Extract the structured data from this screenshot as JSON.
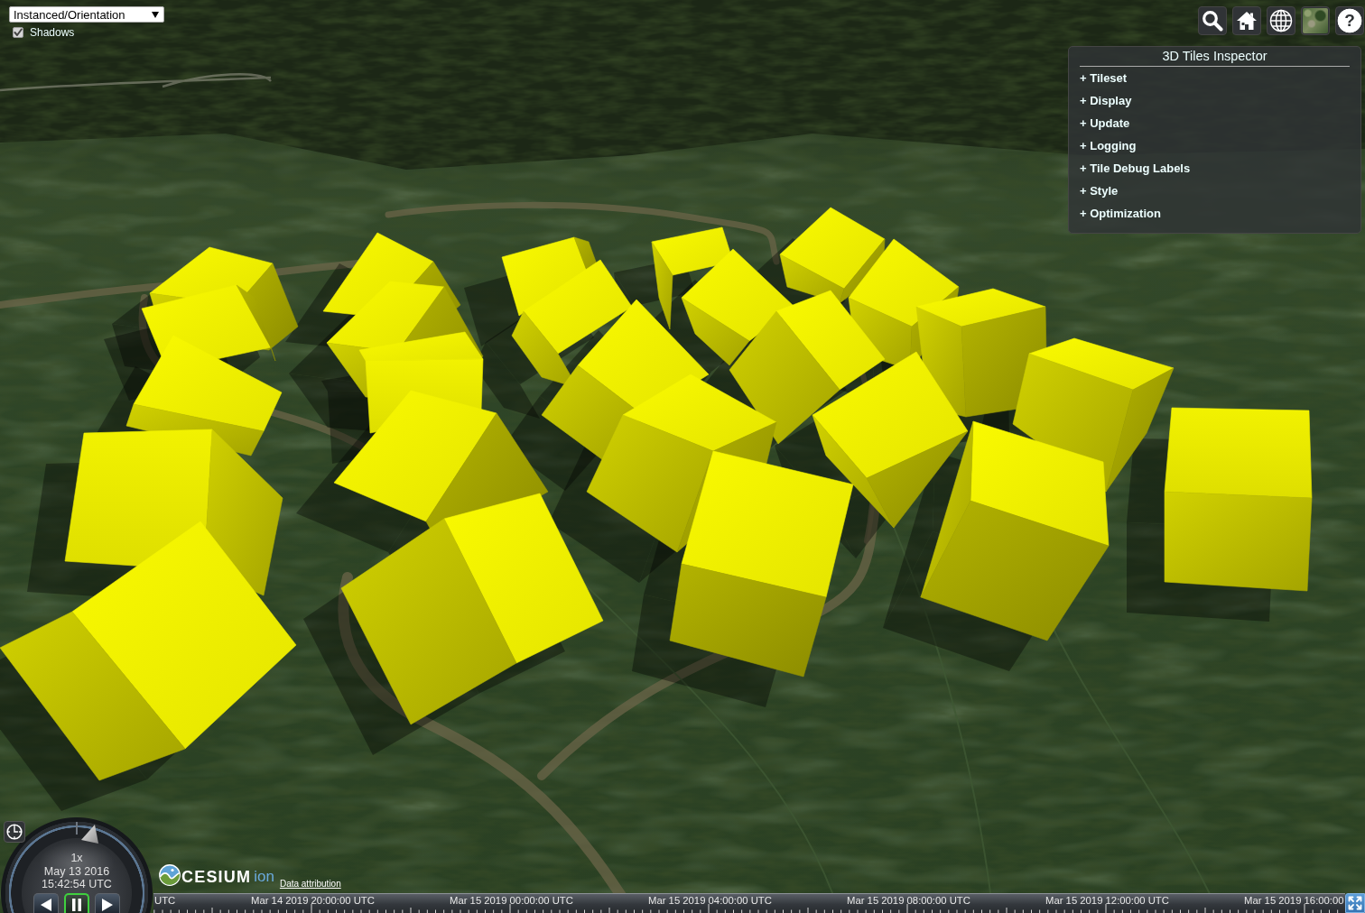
{
  "scene_selector": {
    "value": "Instanced/Orientation"
  },
  "options": [
    {
      "label": "Shadows",
      "checked": true
    }
  ],
  "toolbar": [
    {
      "kind": "search"
    },
    {
      "kind": "home"
    },
    {
      "kind": "globe"
    },
    {
      "kind": "imagery"
    },
    {
      "kind": "help",
      "label": "?"
    }
  ],
  "inspector": {
    "title": "3D Tiles Inspector",
    "sections": [
      "+ Tileset",
      "+ Display",
      "+ Update",
      "+ Logging",
      "+ Tile Debug Labels",
      "+ Style",
      "+ Optimization"
    ]
  },
  "animation": {
    "speed": "1x",
    "date": "May 13 2016",
    "time": "15:42:54 UTC",
    "controls": [
      {
        "kind": "reverse",
        "selected": false
      },
      {
        "kind": "pause",
        "selected": true
      },
      {
        "kind": "play",
        "selected": false
      }
    ]
  },
  "credits": {
    "logo_text": "CESIUM",
    "logo_suffix": "ion",
    "link": "Data attribution"
  },
  "timeline": {
    "labels": [
      "UTC",
      "Mar 14 2019 20:00:00 UTC",
      "Mar 15 2019 00:00:00 UTC",
      "Mar 15 2019 04:00:00 UTC",
      "Mar 15 2019 08:00:00 UTC",
      "Mar 15 2019 12:00:00 UTC",
      "Mar 15 2019 16:00:00"
    ]
  }
}
